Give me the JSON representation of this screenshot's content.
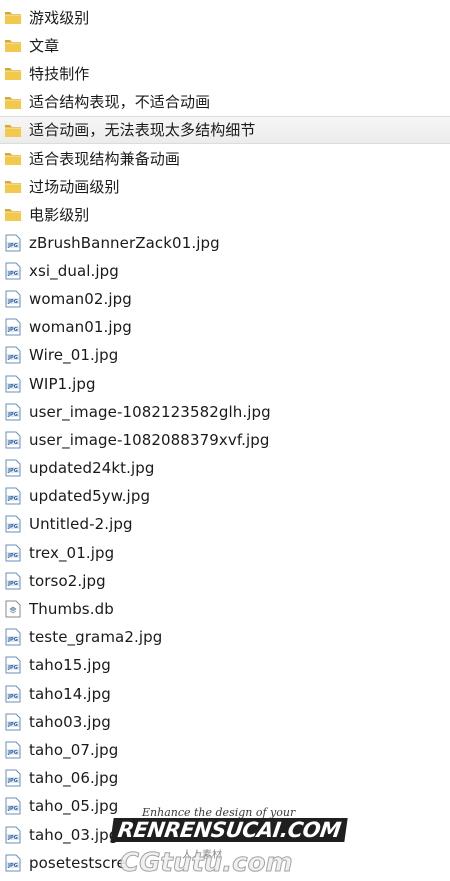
{
  "items": [
    {
      "type": "folder",
      "name": "游戏级别"
    },
    {
      "type": "folder",
      "name": "文章"
    },
    {
      "type": "folder",
      "name": "特技制作"
    },
    {
      "type": "folder",
      "name": "适合结构表现，不适合动画"
    },
    {
      "type": "folder",
      "name": "适合动画，无法表现太多结构细节",
      "hovered": true
    },
    {
      "type": "folder",
      "name": "适合表现结构兼备动画"
    },
    {
      "type": "folder",
      "name": "过场动画级别"
    },
    {
      "type": "folder",
      "name": "电影级别"
    },
    {
      "type": "jpg",
      "name": "zBrushBannerZack01.jpg"
    },
    {
      "type": "jpg",
      "name": "xsi_dual.jpg"
    },
    {
      "type": "jpg",
      "name": "woman02.jpg"
    },
    {
      "type": "jpg",
      "name": "woman01.jpg"
    },
    {
      "type": "jpg",
      "name": "Wire_01.jpg"
    },
    {
      "type": "jpg",
      "name": "WIP1.jpg"
    },
    {
      "type": "jpg",
      "name": "user_image-1082123582glh.jpg"
    },
    {
      "type": "jpg",
      "name": "user_image-1082088379xvf.jpg"
    },
    {
      "type": "jpg",
      "name": "updated24kt.jpg"
    },
    {
      "type": "jpg",
      "name": "updated5yw.jpg"
    },
    {
      "type": "jpg",
      "name": "Untitled-2.jpg"
    },
    {
      "type": "jpg",
      "name": "trex_01.jpg"
    },
    {
      "type": "jpg",
      "name": "torso2.jpg"
    },
    {
      "type": "db",
      "name": "Thumbs.db"
    },
    {
      "type": "jpg",
      "name": "teste_grama2.jpg"
    },
    {
      "type": "jpg",
      "name": "taho15.jpg"
    },
    {
      "type": "jpg",
      "name": "taho14.jpg"
    },
    {
      "type": "jpg",
      "name": "taho03.jpg"
    },
    {
      "type": "jpg",
      "name": "taho_07.jpg"
    },
    {
      "type": "jpg",
      "name": "taho_06.jpg"
    },
    {
      "type": "jpg",
      "name": "taho_05.jpg"
    },
    {
      "type": "jpg",
      "name": "taho_03.jpg"
    },
    {
      "type": "jpg",
      "name": "posetestscre"
    }
  ],
  "icons": {
    "folder": "folder-icon",
    "jpg": "jpeg-image-icon",
    "db": "database-file-icon"
  },
  "colors": {
    "folder_fill": "#f2c94c",
    "folder_back": "#d9a62e",
    "jpg_border": "#6b8fb8",
    "jpg_fill": "#dfe9f5",
    "hover_bg": "#ececec"
  },
  "watermark": {
    "tagline": "Enhance the design of your",
    "logo": "RENRENSUCAI.COM",
    "sub": "人人素材",
    "site": "CGtutu.com"
  }
}
